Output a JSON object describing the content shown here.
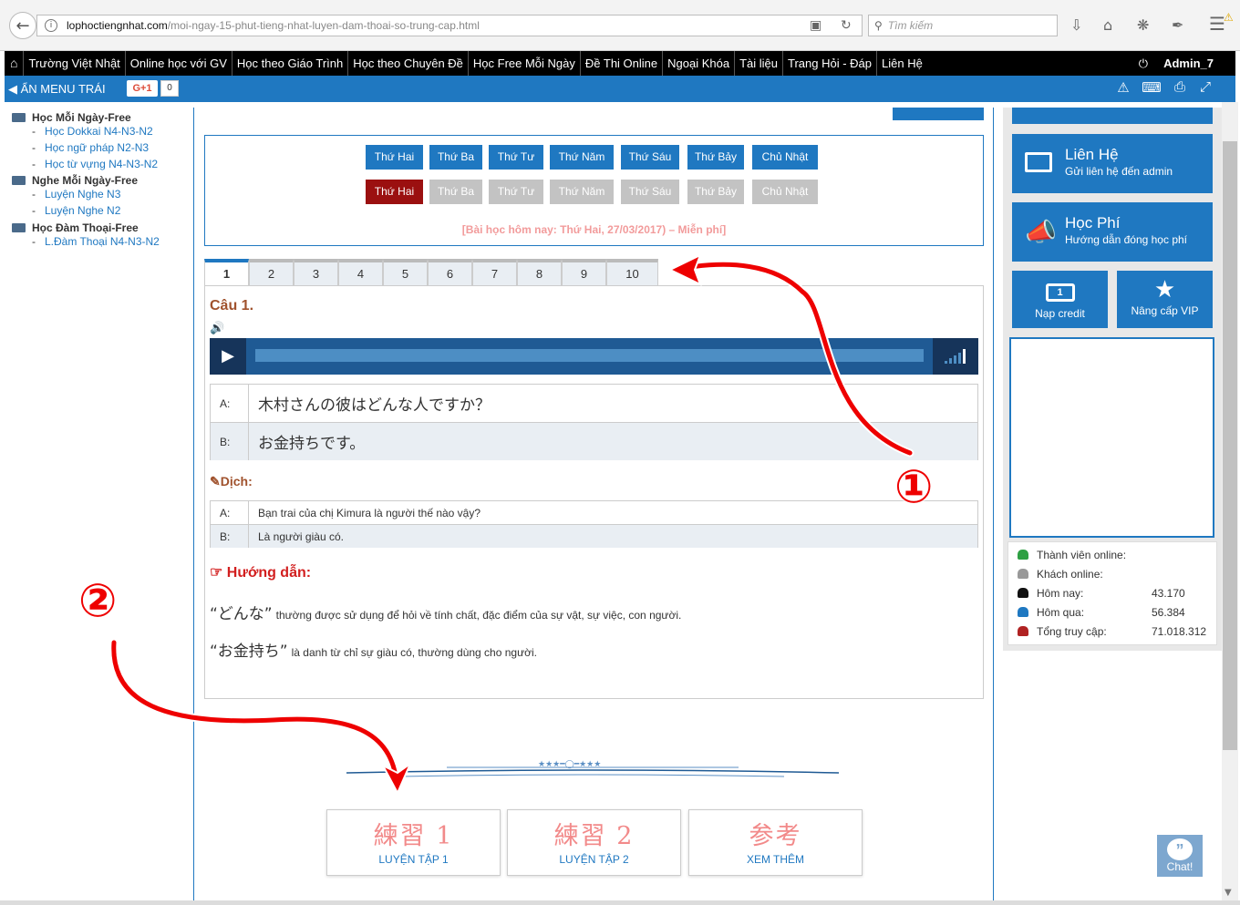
{
  "browser": {
    "url_domain": "lophoctiengnhat.com",
    "url_path": "/moi-ngay-15-phut-tieng-nhat-luyen-dam-thoai-so-trung-cap.html",
    "search_placeholder": "Tìm kiếm"
  },
  "topnav": {
    "items": [
      "Trường Việt Nhật",
      "Online học với GV",
      "Học theo Giáo Trình",
      "Học theo Chuyên Đề",
      "Học Free Mỗi Ngày",
      "Đề Thi Online",
      "Ngoại Khóa",
      "Tài liệu",
      "Trang Hỏi - Đáp",
      "Liên Hệ"
    ],
    "user": "Admin_7"
  },
  "bluebar": {
    "hide_menu": "ẨN MENU TRÁI",
    "gplus": "G+1",
    "gplus_count": "0"
  },
  "leftmenu": {
    "sections": [
      {
        "title": "Học Mỗi Ngày-Free",
        "items": [
          "Học Dokkai N4-N3-N2",
          "Học ngữ pháp N2-N3",
          "Học từ vựng N4-N3-N2"
        ]
      },
      {
        "title": "Nghe Mỗi Ngày-Free",
        "items": [
          "Luyện Nghe N3",
          "Luyện Nghe N2"
        ]
      },
      {
        "title": "Học Đàm Thoại-Free",
        "items": [
          "L.Đàm Thoại N4-N3-N2"
        ]
      }
    ]
  },
  "days": {
    "row1": [
      "Thứ Hai",
      "Thứ Ba",
      "Thứ Tư",
      "Thứ Năm",
      "Thứ Sáu",
      "Thứ Bảy",
      "Chủ Nhật"
    ],
    "row2": [
      "Thứ Hai",
      "Thứ Ba",
      "Thứ Tư",
      "Thứ Năm",
      "Thứ Sáu",
      "Thứ Bảy",
      "Chủ Nhật"
    ],
    "today_text": "[Bài học hôm nay: Thứ Hai, 27/03/2017) – Miễn phí]",
    "colors": {
      "active": "#1f78c1",
      "selected": "#9b1010",
      "disabled": "#c3c3c3"
    }
  },
  "tabs": [
    "1",
    "2",
    "3",
    "4",
    "5",
    "6",
    "7",
    "8",
    "9",
    "10"
  ],
  "question": {
    "title": "Câu 1.",
    "dialogue": [
      {
        "speaker": "A:",
        "text": "木村さんの彼はどんな人ですか？"
      },
      {
        "speaker": "B:",
        "text": "お金持ちです。"
      }
    ],
    "dich_label": "Dịch:",
    "translation": [
      {
        "speaker": "A:",
        "text": "Bạn trai của chị Kimura là người thế nào vậy?"
      },
      {
        "speaker": "B:",
        "text": "Là người giàu có."
      }
    ],
    "huongdan_label": "Hướng dẫn:",
    "guide": [
      {
        "jp": "“どんな”",
        "vn": "thường được sử dụng để hỏi về tính chất, đặc điểm của sự vật, sự việc, con người."
      },
      {
        "jp": "“お金持ち”",
        "vn": "là danh từ chỉ sự giàu có, thường dùng cho người."
      }
    ]
  },
  "practice": [
    {
      "big": "練習 1",
      "small": "LUYỆN TẬP 1"
    },
    {
      "big": "練習 2",
      "small": "LUYỆN TẬP 2"
    },
    {
      "big": "参考",
      "small": "XEM THÊM"
    }
  ],
  "right": {
    "lienhe_title": "Liên Hệ",
    "lienhe_sub": "Gửi liên hệ đến admin",
    "hocphi_title": "Học Phí",
    "hocphi_sub": "Hướng dẫn đóng học phí",
    "napcredit": "Nạp credit",
    "nangcap": "Nâng cấp VIP",
    "stats": [
      {
        "label": "Thành viên online:",
        "value": "",
        "color": "#2ea043"
      },
      {
        "label": "Khách online:",
        "value": "",
        "color": "#999999"
      },
      {
        "label": "Hôm nay:",
        "value": "43.170",
        "color": "#111111"
      },
      {
        "label": "Hôm qua:",
        "value": "56.384",
        "color": "#1f78c1"
      },
      {
        "label": "Tổng truy cập:",
        "value": "71.018.312",
        "color": "#b02222"
      }
    ]
  },
  "chat": "Chat!",
  "annotations": [
    "①",
    "②"
  ]
}
